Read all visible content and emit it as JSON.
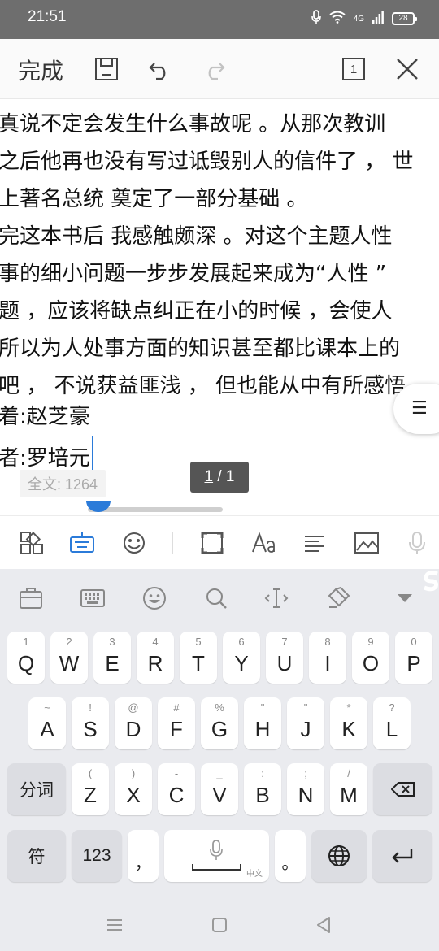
{
  "status_bar": {
    "time": "21:51",
    "network": "4G",
    "battery": "28"
  },
  "toolbar": {
    "done_label": "完成",
    "page_count_badge": "1"
  },
  "document": {
    "lines": [
      "真说不定会发生什么事故呢 。从那次教训",
      "之后他再也没有写过诋毁别人的信件了 ， 世",
      "上著名总统  奠定了一部分基础  。",
      "完这本书后  我感触颇深  。对这个主题人性",
      "事的细小问题一步步发展起来成为“人性  ”",
      "题 ，应该将缺点纠正在小的时候 ，会使人",
      "所以为人处事方面的知识甚至都比课本上的",
      "吧 ，  不说获益匪浅  ，  但也能从中有所感悟",
      "着:赵芝豪",
      "者:罗培元"
    ],
    "word_count_label": "全文: 1264",
    "page_current": "1",
    "page_sep": " / ",
    "page_total": "1"
  },
  "keyboard": {
    "row1": [
      {
        "hint": "1",
        "key": "Q"
      },
      {
        "hint": "2",
        "key": "W"
      },
      {
        "hint": "3",
        "key": "E"
      },
      {
        "hint": "4",
        "key": "R"
      },
      {
        "hint": "5",
        "key": "T"
      },
      {
        "hint": "6",
        "key": "Y"
      },
      {
        "hint": "7",
        "key": "U"
      },
      {
        "hint": "8",
        "key": "I"
      },
      {
        "hint": "9",
        "key": "O"
      },
      {
        "hint": "0",
        "key": "P"
      }
    ],
    "row2": [
      {
        "hint": "~",
        "key": "A"
      },
      {
        "hint": "!",
        "key": "S"
      },
      {
        "hint": "@",
        "key": "D"
      },
      {
        "hint": "#",
        "key": "F"
      },
      {
        "hint": "%",
        "key": "G"
      },
      {
        "hint": "\"",
        "key": "H"
      },
      {
        "hint": "\"",
        "key": "J"
      },
      {
        "hint": "*",
        "key": "K"
      },
      {
        "hint": "?",
        "key": "L"
      }
    ],
    "row3": [
      {
        "hint": "(",
        "key": "Z"
      },
      {
        "hint": ")",
        "key": "X"
      },
      {
        "hint": "-",
        "key": "C"
      },
      {
        "hint": "_",
        "key": "V"
      },
      {
        "hint": ":",
        "key": "B"
      },
      {
        "hint": ";",
        "key": "N"
      },
      {
        "hint": "/",
        "key": "M"
      }
    ],
    "segment_label": "分词",
    "symbol_label": "符",
    "numeric_label": "123",
    "comma_label": "，",
    "period_label": "。",
    "space_tag": "中文"
  },
  "colors": {
    "accent": "#2b7bd9",
    "status_bar": "#6e6e6e",
    "keyboard_bg": "#eaebef"
  }
}
